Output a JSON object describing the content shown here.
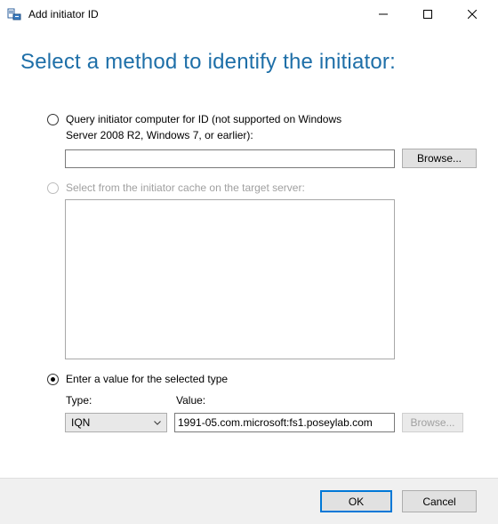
{
  "window": {
    "title": "Add initiator ID"
  },
  "heading": "Select a method to identify the initiator:",
  "option_query": {
    "label_line1": "Query initiator computer for ID (not supported on Windows",
    "label_line2": "Server 2008 R2, Windows 7, or earlier):",
    "input_value": "",
    "browse_label": "Browse..."
  },
  "option_cache": {
    "label": "Select from the initiator cache on the target server:"
  },
  "option_enter": {
    "label": "Enter a value for the selected type",
    "type_label": "Type:",
    "type_value": "IQN",
    "value_label": "Value:",
    "value_text": "1991-05.com.microsoft:fs1.poseylab.com",
    "browse_label": "Browse..."
  },
  "footer": {
    "ok_label": "OK",
    "cancel_label": "Cancel"
  },
  "icons": {
    "app": "iscsi-initiator-icon",
    "minimize": "minimize-icon",
    "maximize": "maximize-icon",
    "close": "close-icon",
    "dropdown": "chevron-down-icon"
  },
  "colors": {
    "heading": "#1e6fa8",
    "accent": "#0078d7"
  }
}
